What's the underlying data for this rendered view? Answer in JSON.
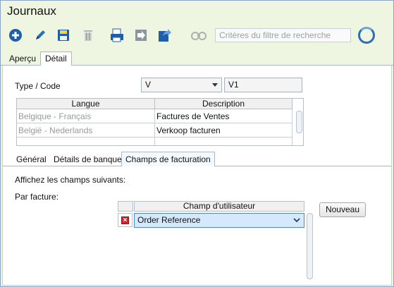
{
  "window": {
    "title": "Journaux"
  },
  "toolbar": {
    "icons": [
      "add-icon",
      "edit-icon",
      "save-icon",
      "delete-icon",
      "print-icon",
      "import-icon",
      "export-icon",
      "binoculars-icon"
    ],
    "search_placeholder": "Critères du filtre de recherche",
    "accent": "#2a6fb5"
  },
  "main_tabs": [
    {
      "label": "Aperçu",
      "active": false
    },
    {
      "label": "Détail",
      "active": true
    }
  ],
  "form": {
    "type_code_label": "Type / Code",
    "type_value": "V",
    "code_value": "V1"
  },
  "lang_grid": {
    "headers": [
      "Langue",
      "Description"
    ],
    "rows": [
      {
        "language": "Belgique - Français",
        "description": "Factures de Ventes"
      },
      {
        "language": "België - Nederlands",
        "description": "Verkoop facturen"
      },
      {
        "language": "",
        "description": ""
      }
    ]
  },
  "sub_tabs": [
    {
      "label": "Général",
      "active": false
    },
    {
      "label": "Détails de banque",
      "active": false
    },
    {
      "label": "Champs de facturation",
      "active": true
    }
  ],
  "billing": {
    "show_fields_label": "Affichez les champs suivants:",
    "per_invoice_label": "Par facture:",
    "grid_header": "Champ d'utilisateur",
    "new_button": "Nouveau",
    "rows": [
      {
        "field": "Order Reference"
      }
    ]
  }
}
